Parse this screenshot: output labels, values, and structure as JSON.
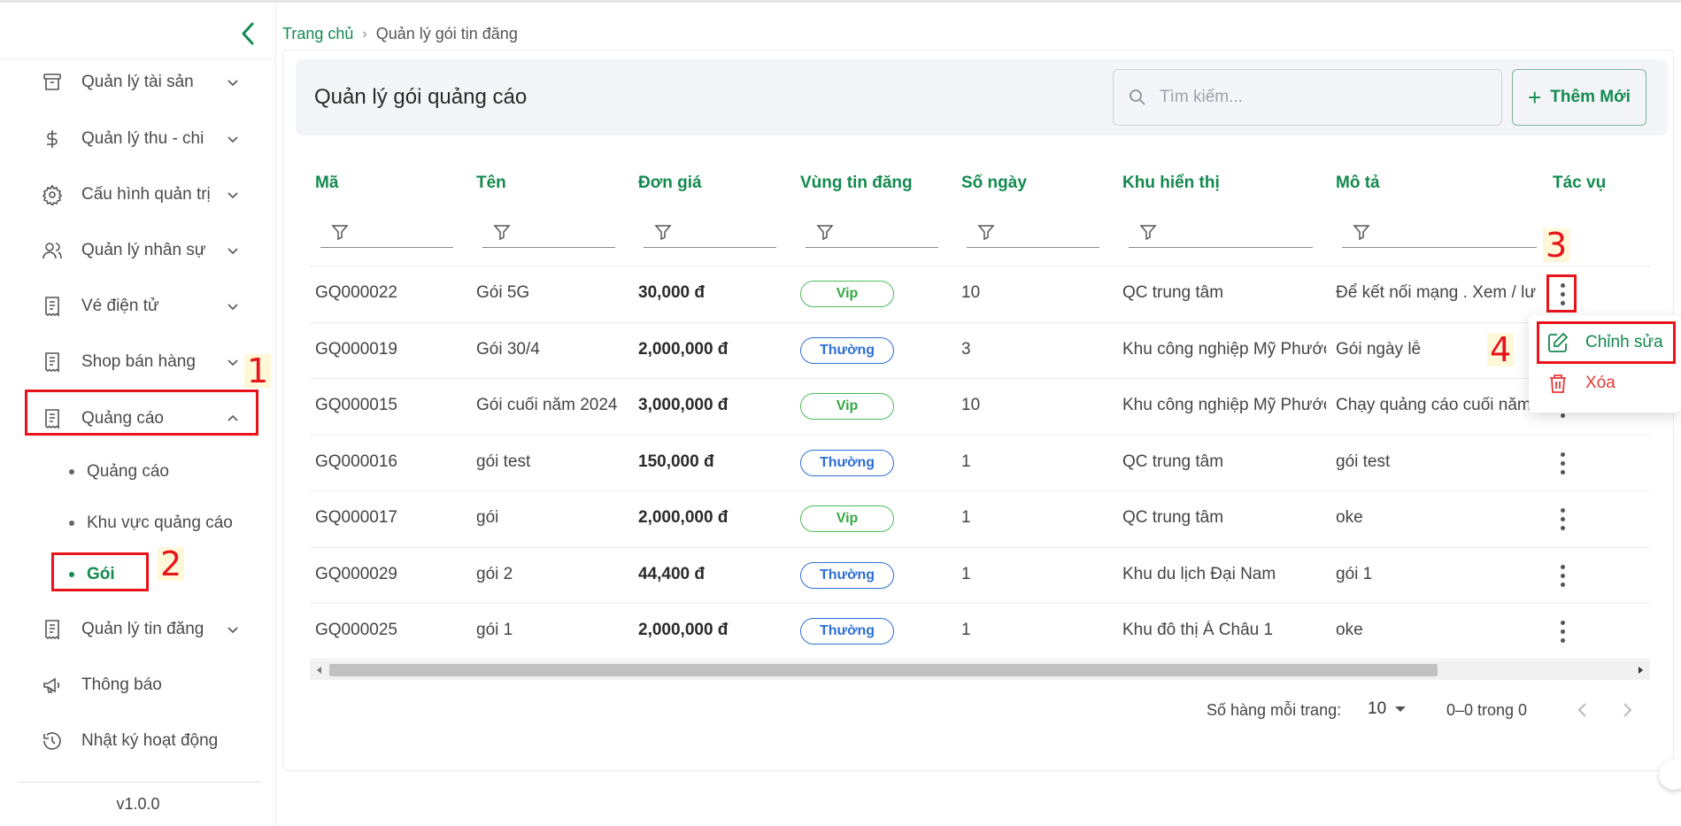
{
  "sidebar": {
    "items": [
      {
        "label": "Quản lý tài sản",
        "icon": "archive-icon"
      },
      {
        "label": "Quản lý thu - chi",
        "icon": "dollar-icon"
      },
      {
        "label": "Cấu hình quản trị",
        "icon": "gear-icon"
      },
      {
        "label": "Quản lý nhân sự",
        "icon": "users-icon"
      },
      {
        "label": "Vé điện tử",
        "icon": "receipt-icon"
      },
      {
        "label": "Shop bán hàng",
        "icon": "receipt-icon"
      },
      {
        "label": "Quảng cáo",
        "icon": "receipt-icon"
      },
      {
        "label": "Quản lý tin đăng",
        "icon": "receipt-icon"
      },
      {
        "label": "Thông báo",
        "icon": "megaphone-icon"
      },
      {
        "label": "Nhật ký hoạt động",
        "icon": "history-icon"
      }
    ],
    "sub_items": [
      "Quảng cáo",
      "Khu vực quảng cáo",
      "Gói"
    ],
    "version": "v1.0.0"
  },
  "annotations": [
    "1",
    "2",
    "3",
    "4"
  ],
  "breadcrumb": {
    "home": "Trang chủ",
    "separator": "›",
    "current": "Quản lý gói tin đăng"
  },
  "header": {
    "title": "Quản lý gói quảng cáo",
    "search_placeholder": "Tìm kiếm...",
    "add_label": "Thêm Mới"
  },
  "table": {
    "columns": [
      "Mã",
      "Tên",
      "Đơn giá",
      "Vùng tin đăng",
      "Số ngày",
      "Khu hiển thị",
      "Mô tả",
      "Tác vụ"
    ],
    "rows": [
      {
        "code": "GQ000022",
        "name": "Gói 5G",
        "price": "30,000 đ",
        "zone": "Vip",
        "days": "10",
        "area": "QC trung tâm",
        "desc": "Để kết nối mạng . Xem / lướt"
      },
      {
        "code": "GQ000019",
        "name": "Gói 30/4",
        "price": "2,000,000 đ",
        "zone": "Thường",
        "days": "3",
        "area": "Khu công nghiệp Mỹ Phước",
        "desc": "Gói ngày lễ"
      },
      {
        "code": "GQ000015",
        "name": "Gói cuối năm 2024",
        "price": "3,000,000 đ",
        "zone": "Vip",
        "days": "10",
        "area": "Khu công nghiệp Mỹ Phước",
        "desc": "Chạy quảng cáo cuối năm"
      },
      {
        "code": "GQ000016",
        "name": "gói test",
        "price": "150,000 đ",
        "zone": "Thường",
        "days": "1",
        "area": "QC trung tâm",
        "desc": "gói test"
      },
      {
        "code": "GQ000017",
        "name": "gói",
        "price": "2,000,000 đ",
        "zone": "Vip",
        "days": "1",
        "area": "QC trung tâm",
        "desc": "oke"
      },
      {
        "code": "GQ000029",
        "name": "gói 2",
        "price": "44,400 đ",
        "zone": "Thường",
        "days": "1",
        "area": "Khu du lịch Đại Nam",
        "desc": "gói 1"
      },
      {
        "code": "GQ000025",
        "name": "gói 1",
        "price": "2,000,000 đ",
        "zone": "Thường",
        "days": "1",
        "area": "Khu đô thị Á Châu 1",
        "desc": "oke"
      }
    ]
  },
  "pagination": {
    "rows_label": "Số hàng mỗi trang:",
    "rows_value": "10",
    "range": "0–0 trong 0"
  },
  "popup": {
    "edit_label": "Chỉnh sửa",
    "delete_label": "Xóa"
  },
  "colors": {
    "accent": "#138a4f",
    "annotation": "#e8141a",
    "vip": "#34a845",
    "normal": "#2d6fd6",
    "danger": "#e53935"
  }
}
